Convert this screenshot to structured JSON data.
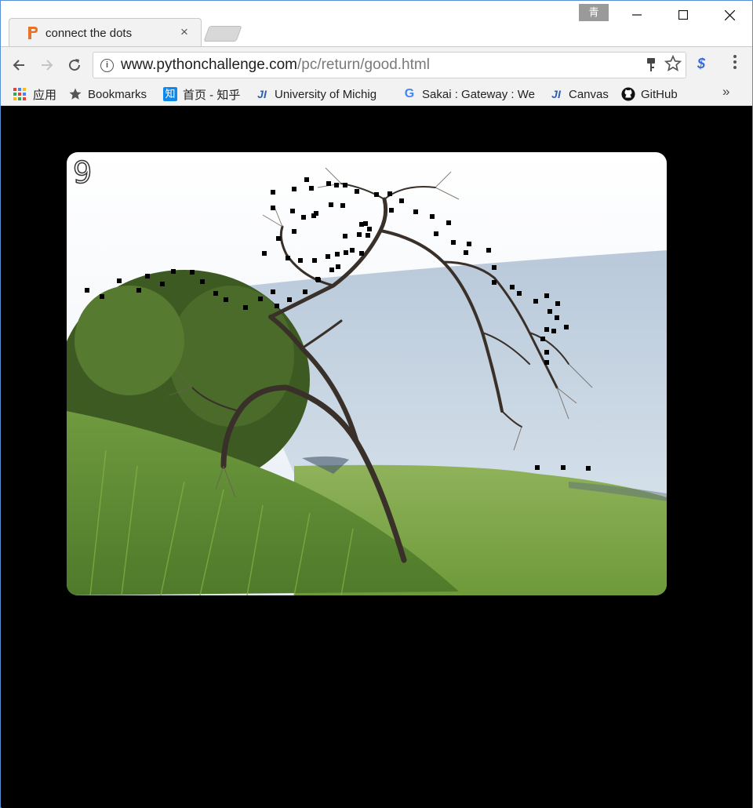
{
  "browser": {
    "profile_label": "青",
    "tab": {
      "title": "connect the dots",
      "close": "×"
    },
    "window_controls": {
      "minimize": "—",
      "maximize": "☐",
      "close": "✕"
    },
    "address": {
      "domain": "www.pythonchallenge.com",
      "path": "/pc/return/good.html"
    },
    "bookmarks": [
      {
        "label": "应用",
        "icon": "apps-grid-icon"
      },
      {
        "label": "Bookmarks",
        "icon": "star-icon"
      },
      {
        "label": "首页 - 知乎",
        "icon": "zhihu-icon",
        "icon_text": "知"
      },
      {
        "label": "University of Michig",
        "icon": "ji-icon",
        "icon_text": "JI"
      },
      {
        "label": "Sakai : Gateway : We",
        "icon": "google-icon",
        "icon_text": "G"
      },
      {
        "label": "Canvas",
        "icon": "ji-icon",
        "icon_text": "JI"
      },
      {
        "label": "GitHub",
        "icon": "github-icon"
      }
    ],
    "more_bookmarks": "»"
  },
  "page": {
    "number": "9",
    "dot_color": "#000000"
  }
}
